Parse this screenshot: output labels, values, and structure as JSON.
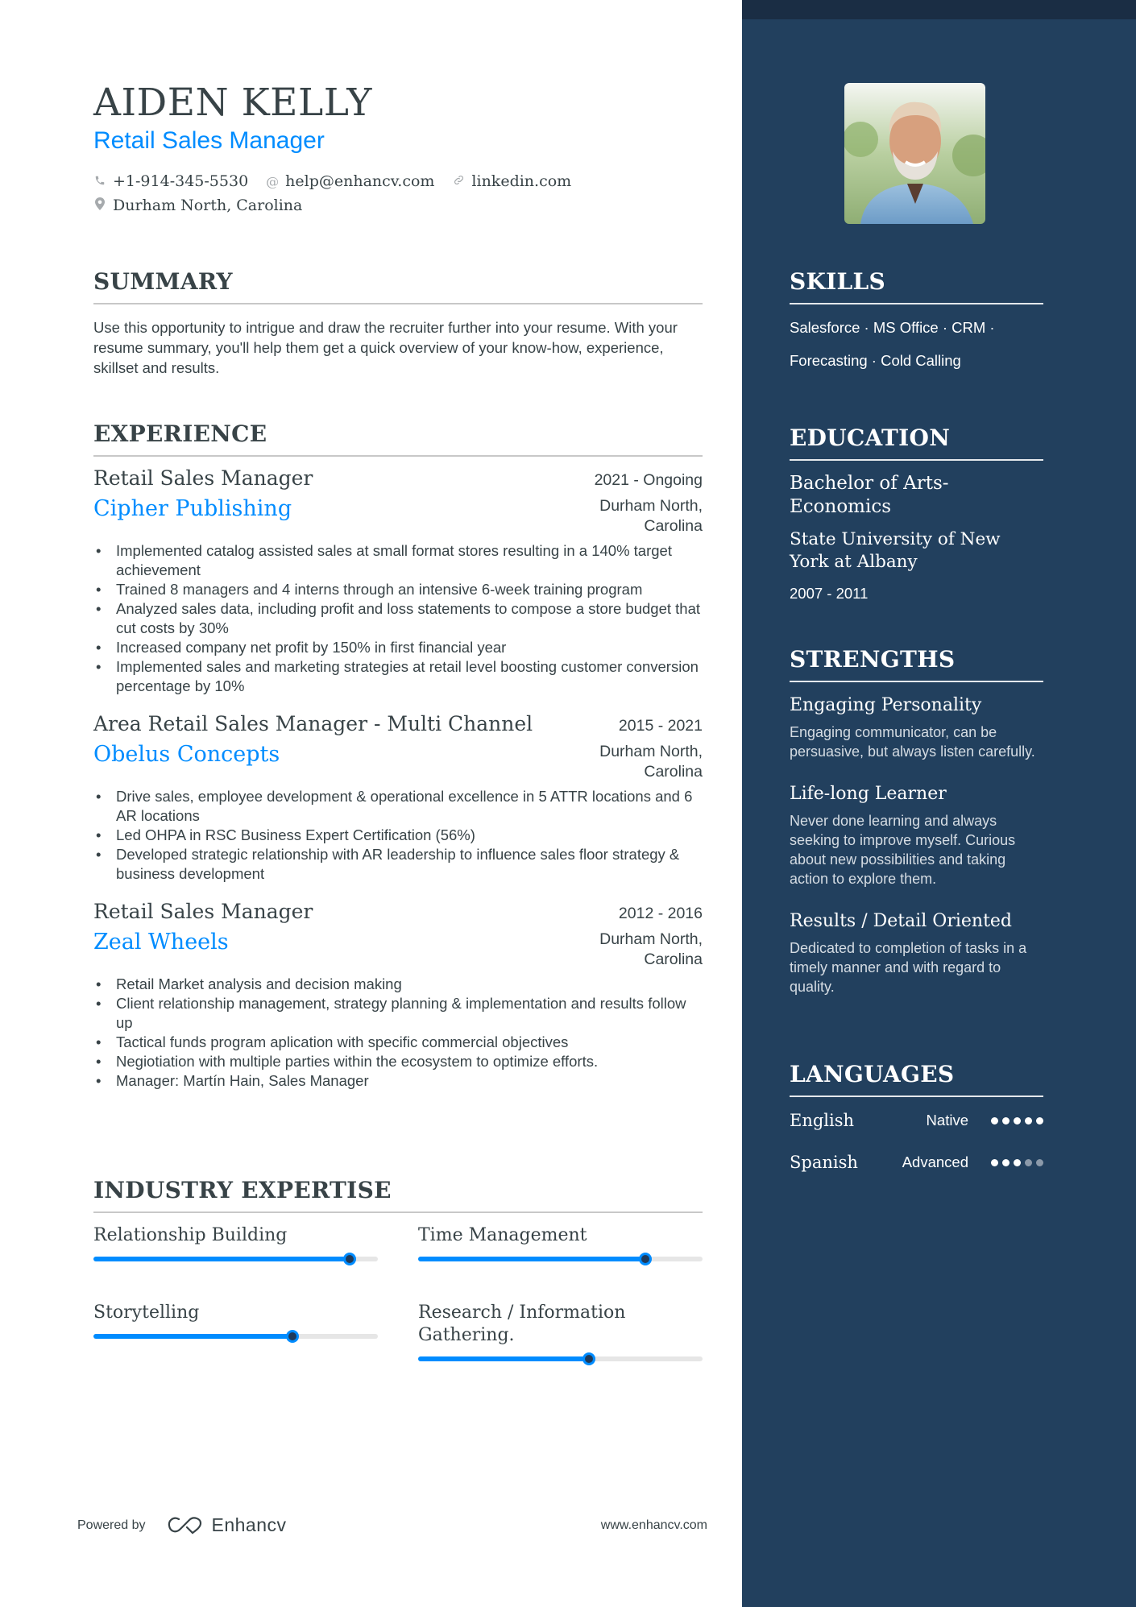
{
  "header": {
    "name": "AIDEN KELLY",
    "role": "Retail Sales Manager",
    "contacts": {
      "phone": "+1-914-345-5530",
      "email": "help@enhancv.com",
      "link": "linkedin.com",
      "location": "Durham North, Carolina"
    },
    "icons": {
      "phone": "phone-icon",
      "email": "at-icon",
      "link": "link-icon",
      "location": "location-pin-icon"
    }
  },
  "summary": {
    "title": "SUMMARY",
    "text": "Use this opportunity to intrigue and draw the recruiter further into your resume. With your resume summary, you'll help them get a quick overview of your know-how, experience, skillset and results."
  },
  "experience": {
    "title": "EXPERIENCE",
    "jobs": [
      {
        "title": "Retail Sales Manager",
        "dates": "2021 - Ongoing",
        "company": "Cipher Publishing",
        "location": "Durham North, Carolina",
        "bullets": [
          "Implemented catalog assisted sales at small format stores resulting in a 140% target achievement",
          "Trained 8 managers and 4 interns through an intensive 6-week training program",
          "Analyzed sales data, including profit and loss statements to compose a store budget that cut costs by 30%",
          "Increased company net profit by 150% in first financial year",
          "Implemented sales and marketing strategies at retail level boosting customer conversion percentage by 10%"
        ]
      },
      {
        "title": "Area Retail Sales Manager - Multi Channel",
        "dates": "2015 - 2021",
        "company": "Obelus Concepts",
        "location": "Durham North, Carolina",
        "bullets": [
          "Drive sales, employee development & operational excellence in 5 ATTR locations and 6 AR locations",
          "Led OHPA in RSC Business Expert Certification (56%)",
          "Developed strategic relationship with AR leadership to influence sales floor strategy & business development"
        ]
      },
      {
        "title": "Retail Sales Manager",
        "dates": "2012 - 2016",
        "company": "Zeal Wheels",
        "location": "Durham North, Carolina",
        "bullets": [
          "Retail Market analysis and decision making",
          "Client relationship management, strategy  planning & implementation and results follow up",
          "Tactical funds program aplication with specific commercial objectives",
          "Negiotiation with multiple parties within the ecosystem to optimize efforts.",
          "Manager: Martín Hain, Sales Manager"
        ]
      }
    ]
  },
  "industry_expertise": {
    "title": "INDUSTRY EXPERTISE",
    "items": [
      {
        "label": "Relationship Building",
        "level": 0.9
      },
      {
        "label": "Time Management",
        "level": 0.8
      },
      {
        "label": "Storytelling",
        "level": 0.7
      },
      {
        "label": "Research / Information Gathering.",
        "level": 0.6
      }
    ]
  },
  "footer": {
    "powered_by": "Powered by",
    "brand": "Enhancv",
    "website": "www.enhancv.com"
  },
  "sidebar": {
    "photo_alt": "Portrait photo",
    "skills": {
      "title": "SKILLS",
      "lines": [
        "Salesforce · MS Office · CRM ·",
        "Forecasting · Cold Calling"
      ]
    },
    "education": {
      "title": "EDUCATION",
      "degree": "Bachelor of Arts-Economics",
      "school": "State University of New York at Albany",
      "dates": "2007 - 2011"
    },
    "strengths": {
      "title": "STRENGTHS",
      "items": [
        {
          "title": "Engaging Personality",
          "description": "Engaging communicator, can be persuasive, but always listen carefully."
        },
        {
          "title": "Life-long Learner",
          "description": "Never done learning and always seeking to improve myself. Curious about new possibilities and taking action to explore them."
        },
        {
          "title": "Results / Detail Oriented",
          "description": "Dedicated to completion of tasks in a timely manner and with regard to quality."
        }
      ]
    },
    "languages": {
      "title": "LANGUAGES",
      "items": [
        {
          "name": "English",
          "level": "Native",
          "rating": 5,
          "max": 5
        },
        {
          "name": "Spanish",
          "level": "Advanced",
          "rating": 3,
          "max": 5
        }
      ]
    }
  },
  "colors": {
    "accent": "#008cff",
    "text": "#384347",
    "sidebar_bg": "#22405e",
    "sidebar_top": "#1a2d44"
  }
}
